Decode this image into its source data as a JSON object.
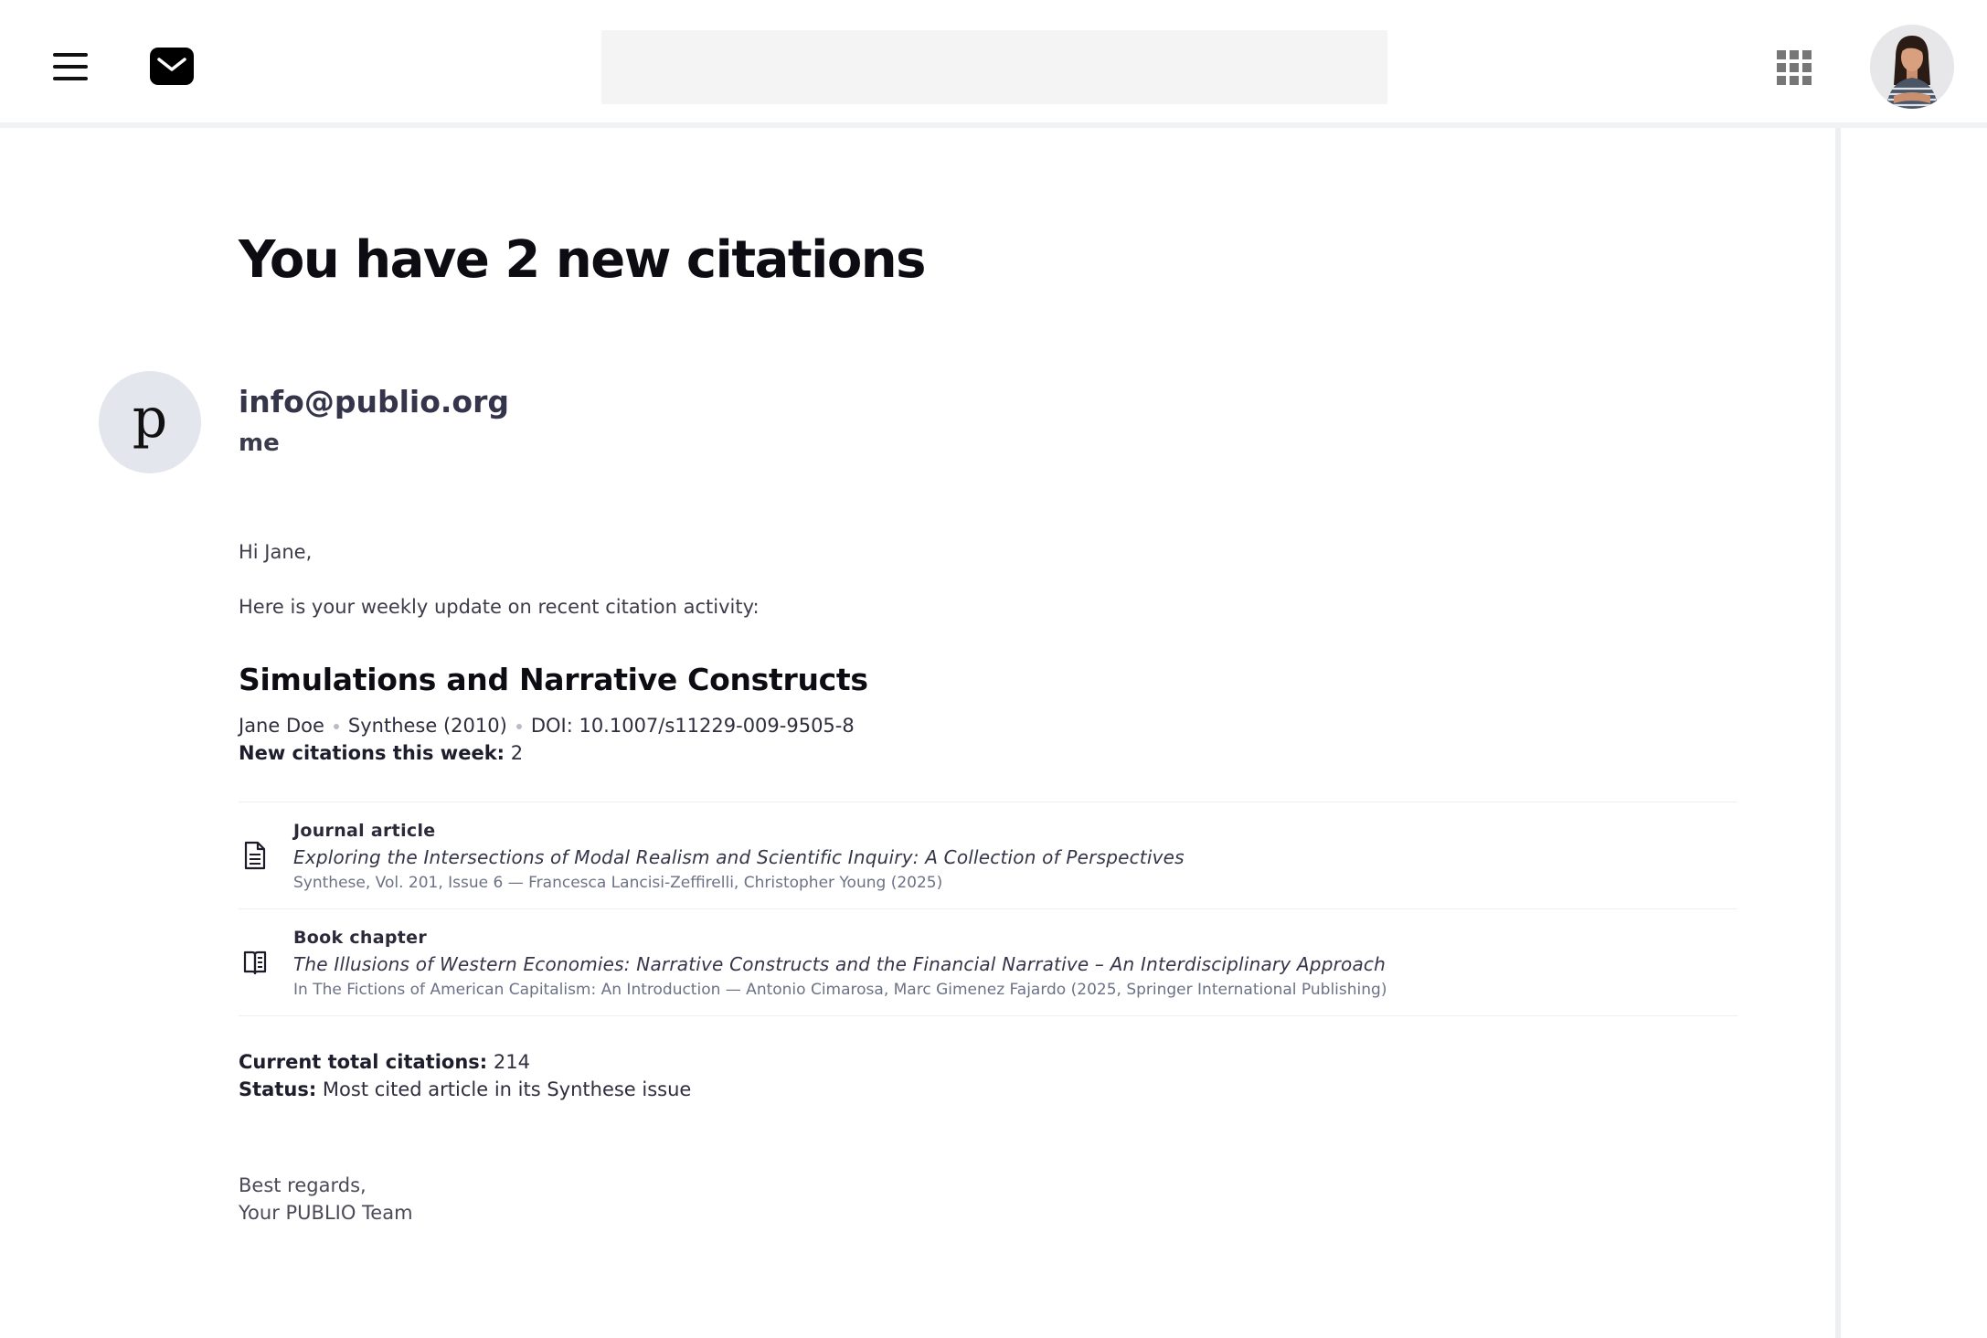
{
  "header": {
    "search_placeholder": "",
    "menu_icon": "hamburger-menu-icon",
    "logo_icon": "mail-icon",
    "apps_icon": "apps-grid-icon",
    "avatar_alt": "User profile"
  },
  "email": {
    "subject": "You have 2 new citations",
    "sender_initial": "p",
    "sender_email": "info@publio.org",
    "recipient": "me",
    "greeting": "Hi Jane,",
    "intro": "Here is your weekly update on recent citation activity:",
    "paper": {
      "title": "Simulations and Narrative Constructs",
      "author": "Jane Doe",
      "venue": "Synthese (2010)",
      "doi": "DOI: 10.1007/s11229-009-9505-8",
      "new_citations_label": "New citations this week:",
      "new_citations_value": "2"
    },
    "citations": [
      {
        "type": "Journal article",
        "icon": "document-icon",
        "title": "Exploring the Intersections of Modal Realism and Scientific Inquiry: A Collection of Perspectives",
        "source": "Synthese, Vol. 201, Issue 6 — Francesca Lancisi-Zeffirelli, Christopher Young (2025)"
      },
      {
        "type": "Book chapter",
        "icon": "book-icon",
        "title": "The Illusions of Western Economies: Narrative Constructs and the Financial Narrative – An Interdisciplinary Approach",
        "source": "In The Fictions of American Capitalism: An Introduction — Antonio Cimarosa, Marc Gimenez Fajardo (2025, Springer International Publishing)"
      }
    ],
    "total_label": "Current total citations:",
    "total_value": "214",
    "status_label": "Status:",
    "status_value": "Most cited article in its Synthese issue",
    "signoff_line1": "Best regards,",
    "signoff_line2": "Your PUBLIO Team"
  },
  "colors": {
    "heading": "#0c0c12",
    "body_text": "#3c3c4a",
    "muted": "#6c7286",
    "sender_avatar_bg": "#e3e6ec",
    "search_bg": "#f4f4f4"
  }
}
